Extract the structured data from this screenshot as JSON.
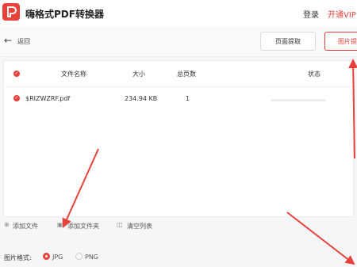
{
  "app": {
    "title": "嗨格式PDF转换器",
    "login_label": "登录",
    "vip_label": "开通VIP",
    "accent_color": "#e8413b"
  },
  "toolbar": {
    "back_label": "返回",
    "back_icon": "arrow-left-icon",
    "extract_label": "页面提取",
    "image_label": "图片提"
  },
  "table": {
    "headers": {
      "name": "文件名称",
      "size": "大小",
      "pages": "总页数",
      "status": "状态"
    },
    "rows": [
      {
        "name": "$RIZWZRF.pdf",
        "size": "234.94 KB",
        "pages": "1",
        "progress": 0
      }
    ]
  },
  "actions": {
    "add_file": "添加文件",
    "add_folder": "添加文件夹",
    "clear_list": "清空列表"
  },
  "format": {
    "label": "图片格式:",
    "options": [
      "JPG",
      "PNG"
    ],
    "selected": "JPG"
  }
}
